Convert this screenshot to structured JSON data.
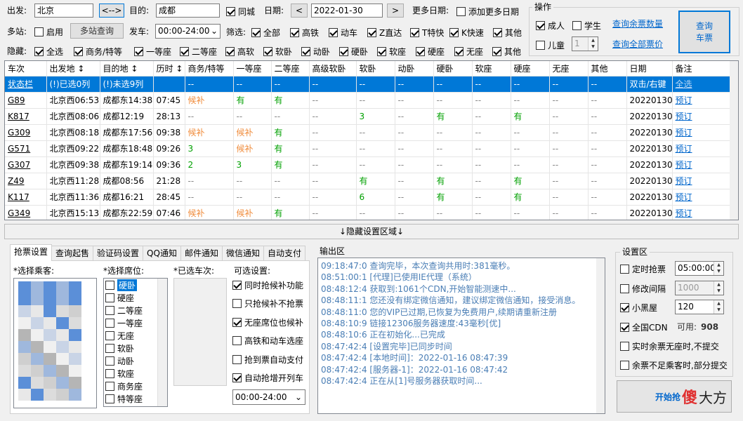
{
  "search": {
    "from_label": "出发:",
    "from_value": "北京",
    "swap_label": "<-->",
    "to_label": "目的:",
    "to_value": "成都",
    "same_city_label": "同城",
    "date_label": "日期:",
    "date_value": "2022-01-30",
    "prev_label": "<",
    "next_label": ">",
    "more_dates_label": "更多日期:",
    "add_more_dates_label": "添加更多日期",
    "multi_station_label": "多站:",
    "enable_label": "启用",
    "multi_query_label": "多站查询",
    "depart_time_label": "发车:",
    "depart_time_value": "00:00-24:00"
  },
  "filter": {
    "label": "筛选:",
    "items": [
      "全部",
      "高铁",
      "动车",
      "Z直达",
      "T特快",
      "K快速",
      "其他"
    ]
  },
  "hide": {
    "label": "隐藏:",
    "items": [
      "全选",
      "商务/特等",
      "一等座",
      "二等座",
      "高软",
      "软卧",
      "动卧",
      "硬卧",
      "软座",
      "硬座",
      "无座",
      "其他"
    ]
  },
  "ops": {
    "title": "操作",
    "adult_label": "成人",
    "student_label": "学生",
    "child_label": "儿童",
    "child_count": "1",
    "query_remaining_label": "查询余票数量",
    "query_price_label": "查询全部票价",
    "query_button_line1": "查询",
    "query_button_line2": "车票"
  },
  "table": {
    "headers": [
      "车次",
      "出发地 ↕",
      "目的地 ↕",
      "历时 ↕",
      "商务/特等",
      "一等座",
      "二等座",
      "高级软卧",
      "软卧",
      "动卧",
      "硬卧",
      "软座",
      "硬座",
      "无座",
      "其他",
      "日期",
      "备注"
    ],
    "status_row": [
      "状态栏",
      "(!)已选0列",
      "(!)未选9列",
      "",
      "--",
      "--",
      "--",
      "--",
      "--",
      "--",
      "--",
      "--",
      "--",
      "--",
      "--",
      "双击/右键",
      "全选"
    ],
    "rows": [
      [
        "G89",
        "北京西06:53",
        "成都东14:38",
        "07:45",
        "候补",
        "有",
        "有",
        "--",
        "--",
        "--",
        "--",
        "--",
        "--",
        "--",
        "--",
        "20220130",
        "预订"
      ],
      [
        "K817",
        "北京西08:06",
        "成都12:19",
        "28:13",
        "--",
        "--",
        "--",
        "--",
        "3",
        "--",
        "有",
        "--",
        "有",
        "--",
        "--",
        "20220130",
        "预订"
      ],
      [
        "G309",
        "北京西08:18",
        "成都东17:56",
        "09:38",
        "候补",
        "候补",
        "有",
        "--",
        "--",
        "--",
        "--",
        "--",
        "--",
        "--",
        "--",
        "20220130",
        "预订"
      ],
      [
        "G571",
        "北京西09:22",
        "成都东18:48",
        "09:26",
        "3",
        "候补",
        "有",
        "--",
        "--",
        "--",
        "--",
        "--",
        "--",
        "--",
        "--",
        "20220130",
        "预订"
      ],
      [
        "G307",
        "北京西09:38",
        "成都东19:14",
        "09:36",
        "2",
        "3",
        "有",
        "--",
        "--",
        "--",
        "--",
        "--",
        "--",
        "--",
        "--",
        "20220130",
        "预订"
      ],
      [
        "Z49",
        "北京西11:28",
        "成都08:56",
        "21:28",
        "--",
        "--",
        "--",
        "--",
        "有",
        "--",
        "有",
        "--",
        "有",
        "--",
        "--",
        "20220130",
        "预订"
      ],
      [
        "K117",
        "北京西11:36",
        "成都16:21",
        "28:45",
        "--",
        "--",
        "--",
        "--",
        "6",
        "--",
        "有",
        "--",
        "有",
        "--",
        "--",
        "20220130",
        "预订"
      ],
      [
        "G349",
        "北京西15:13",
        "成都东22:59",
        "07:46",
        "候补",
        "候补",
        "有",
        "--",
        "--",
        "--",
        "--",
        "--",
        "--",
        "--",
        "--",
        "20220130",
        "预订"
      ]
    ]
  },
  "hide_settings_label": "↓隐藏设置区域↓",
  "tabs": [
    "抢票设置",
    "查询起售",
    "验证码设置",
    "QQ通知",
    "邮件通知",
    "微信通知",
    "自动支付"
  ],
  "booking": {
    "passengers_label": "*选择乘客:",
    "seats_label": "*选择席位:",
    "seats": [
      "硬卧",
      "硬座",
      "二等座",
      "一等座",
      "无座",
      "软卧",
      "动卧",
      "软座",
      "商务座",
      "特等座"
    ],
    "selected_trains_label": "*已选车次:",
    "options_label": "可选设置:",
    "options": [
      {
        "label": "同时抢候补功能",
        "checked": true
      },
      {
        "label": "只抢候补不抢票",
        "checked": false
      },
      {
        "label": "无座席位也候补",
        "checked": true
      },
      {
        "label": "高铁和动车选座",
        "checked": false
      },
      {
        "label": "抢到票自动支付",
        "checked": false
      },
      {
        "label": "自动抢增开列车",
        "checked": true
      }
    ],
    "time_range_value": "00:00-24:00"
  },
  "output": {
    "title": "输出区",
    "lines": [
      "09:18:47:0  查询完毕，本次查询共用时:381毫秒。",
      "08:51:00:1  [代理]已使用IE代理（系统）",
      "08:48:12:4  获取到:1061个CDN,开始智能测速中...",
      "08:48:11:1  您还没有绑定微信通知，建议绑定微信通知，接受消息。",
      "08:48:11:0  您的VIP已过期,已恢复为免费用户,续期请重新注册",
      "08:48:10:9  链接12306服务器速度:43毫秒[优]",
      "08:48:10:6  正在初始化...已完成",
      "08:47:42:4  [设置完毕]已同步时间",
      "08:47:42:4  [本地时间]：2022-01-16 08:47:39",
      "08:47:42:4  [服务器-1]：2022-01-16 08:47:42",
      "08:47:42:4  正在从[1]号服务器获取时间..."
    ]
  },
  "settings": {
    "title": "设置区",
    "timed_label": "定时抢票",
    "timed_value": "05:00:00",
    "interval_label": "修改间隔",
    "interval_value": "1000",
    "blackroom_label": "小黑屋",
    "blackroom_value": "120",
    "cdn_label": "全国CDN",
    "cdn_available_label": "可用:",
    "cdn_available_value": "908",
    "realtime_label": "实时余票无座时,不提交",
    "partial_label": "余票不足乘客时,部分提交",
    "start_label": "开始抢",
    "watermark_a": "傻",
    "watermark_b": "大方"
  }
}
